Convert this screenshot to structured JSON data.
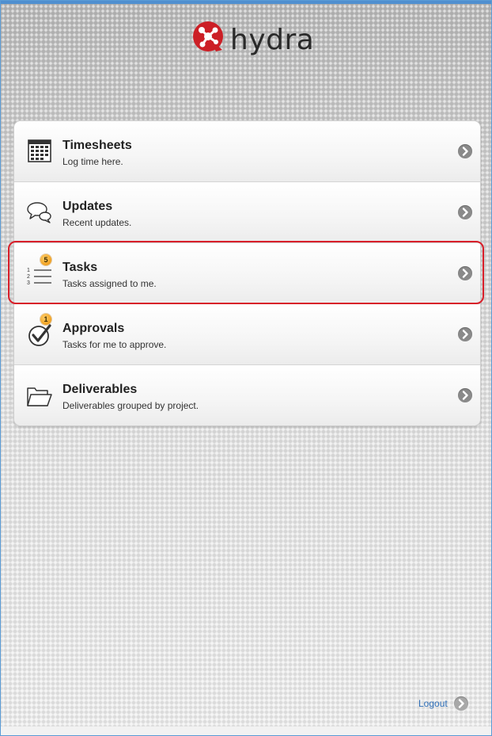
{
  "brand": {
    "name": "hydra",
    "logo_color": "#cc1f26"
  },
  "menu": {
    "items": [
      {
        "title": "Timesheets",
        "subtitle": "Log time here.",
        "icon": "calendar-grid-icon",
        "badge": ""
      },
      {
        "title": "Updates",
        "subtitle": "Recent updates.",
        "icon": "speech-bubbles-icon",
        "badge": ""
      },
      {
        "title": "Tasks",
        "subtitle": "Tasks assigned to me.",
        "icon": "numbered-list-icon",
        "badge": "5"
      },
      {
        "title": "Approvals",
        "subtitle": "Tasks for me to approve.",
        "icon": "checkmark-circle-icon",
        "badge": "1"
      },
      {
        "title": "Deliverables",
        "subtitle": "Deliverables grouped by project.",
        "icon": "folder-icon",
        "badge": ""
      }
    ],
    "list_numbers": [
      "1",
      "2",
      "3"
    ]
  },
  "footer": {
    "logout_label": "Logout"
  },
  "colors": {
    "accent_blue": "#4f8fcf",
    "highlight_red": "#d81f2a",
    "badge_orange": "#f0a020",
    "link_blue": "#2f6fb8"
  }
}
